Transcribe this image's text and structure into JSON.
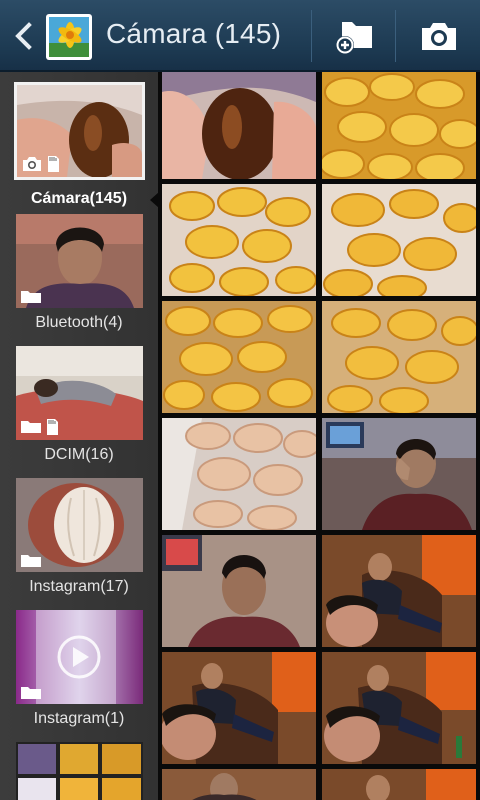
{
  "header": {
    "title": "Cámara (145)",
    "back_icon": "chevron-left-icon",
    "app_icon": "gallery-flower-icon",
    "new_album_icon": "folder-add-icon",
    "camera_icon": "camera-icon",
    "colors": {
      "bar": "#1d3a52",
      "text": "#e6edf3",
      "separator": "#3b5f7d"
    }
  },
  "sidebar": {
    "albums": [
      {
        "label": "Cámara(145)",
        "selected": true,
        "badges": [
          "camera-icon",
          "sd-card-icon"
        ]
      },
      {
        "label": "Bluetooth(4)",
        "selected": false,
        "badges": [
          "folder-icon"
        ]
      },
      {
        "label": "DCIM(16)",
        "selected": false,
        "badges": [
          "folder-icon",
          "sd-card-icon"
        ]
      },
      {
        "label": "Instagram(17)",
        "selected": false,
        "badges": [
          "folder-icon"
        ]
      },
      {
        "label": "Instagram(1)",
        "selected": false,
        "badges": [
          "folder-icon",
          "play-icon"
        ]
      }
    ],
    "colors": {
      "background": "#363636",
      "label": "#e4e4e4"
    }
  },
  "grid": {
    "columns": 2,
    "photos": [
      "hand-holding-fruit",
      "snacks-yellow",
      "snacks-yellow",
      "snacks-yellow",
      "snacks-yellow",
      "snacks-yellow",
      "snacks-pale",
      "man-selfie-hand-on-head",
      "man-portrait",
      "room-people-selfie",
      "room-people-selfie",
      "room-people-selfie",
      "room-man-wall",
      "room-people-selfie"
    ]
  }
}
